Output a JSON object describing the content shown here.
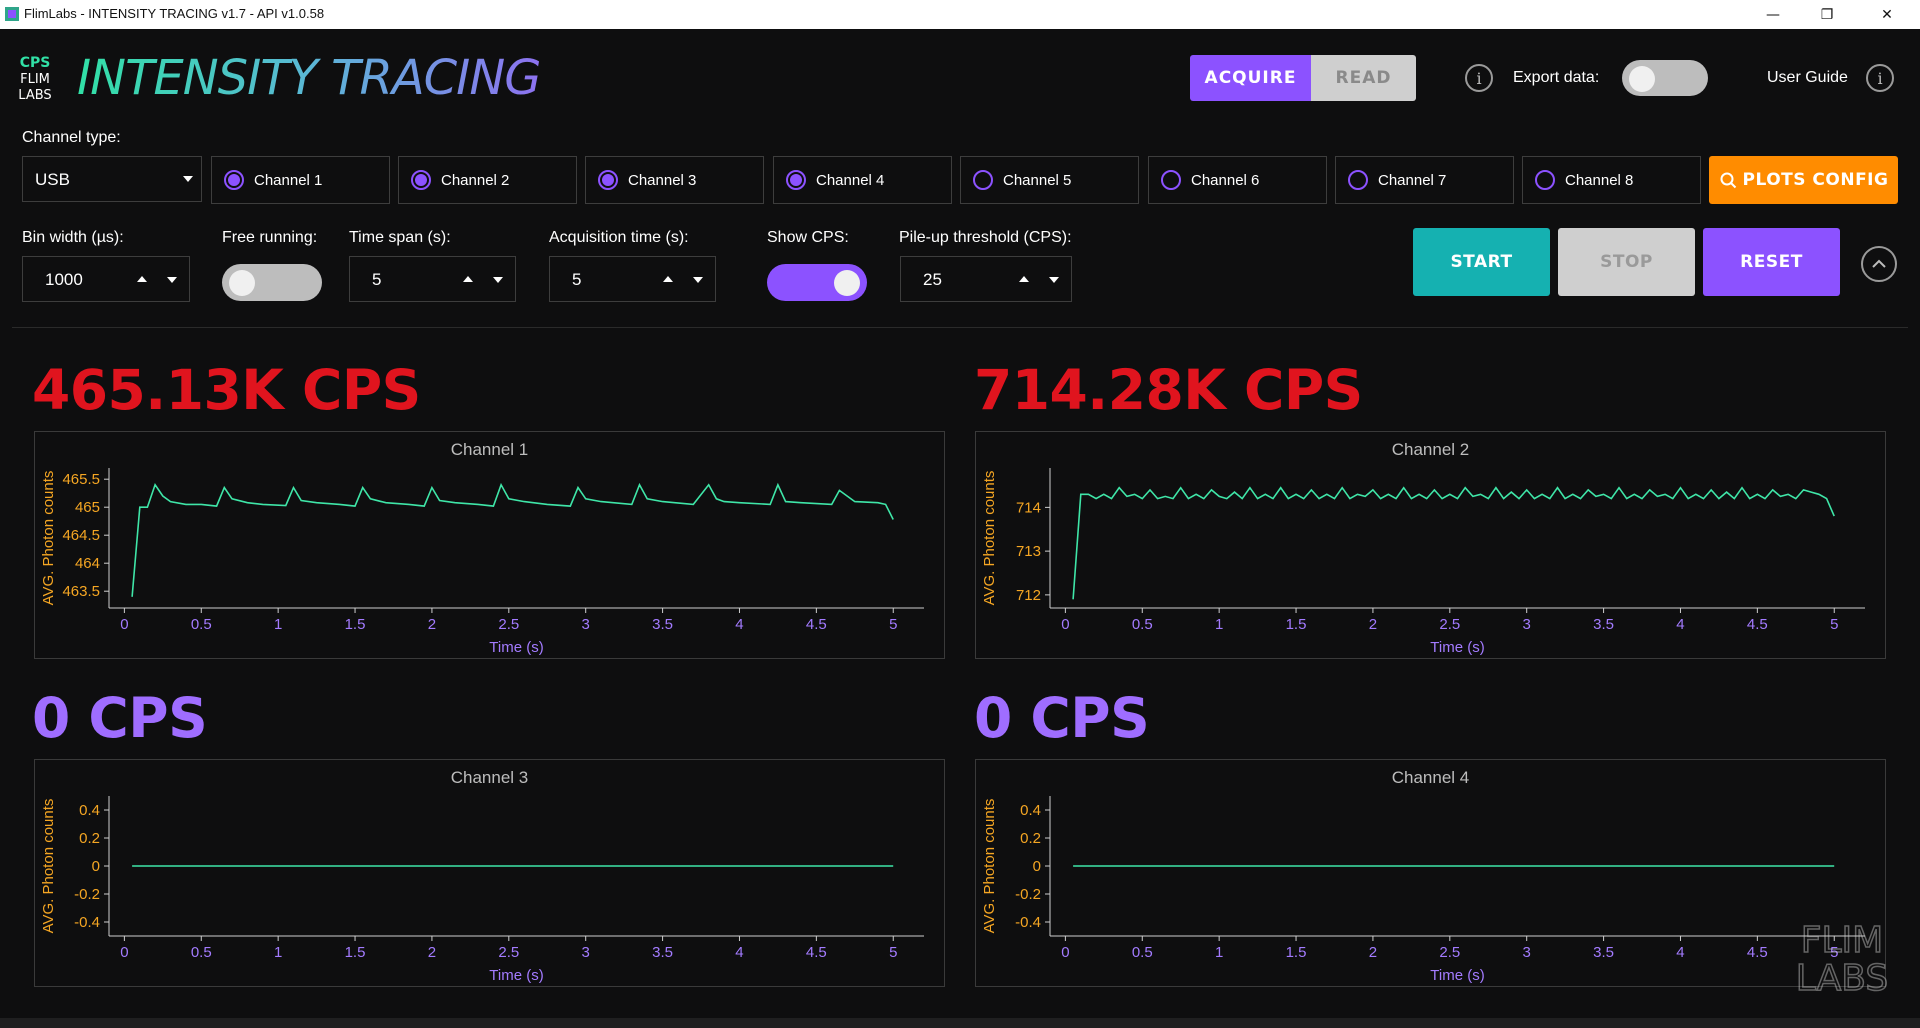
{
  "window": {
    "title": "FlimLabs - INTENSITY TRACING v1.7 - API v1.0.58",
    "minimize": "—",
    "maximize": "❐",
    "close": "✕"
  },
  "header": {
    "app_title": "INTENSITY TRACING",
    "logo_text": "CPS FLIM LABS",
    "mode_acquire": "ACQUIRE",
    "mode_read": "READ",
    "export_label": "Export data:",
    "export_on": false,
    "user_guide": "User Guide"
  },
  "controls": {
    "channel_type_label": "Channel type:",
    "channel_type_value": "USB",
    "channels": [
      {
        "label": "Channel 1",
        "checked": true
      },
      {
        "label": "Channel 2",
        "checked": true
      },
      {
        "label": "Channel 3",
        "checked": true
      },
      {
        "label": "Channel 4",
        "checked": true
      },
      {
        "label": "Channel 5",
        "checked": false
      },
      {
        "label": "Channel 6",
        "checked": false
      },
      {
        "label": "Channel 7",
        "checked": false
      },
      {
        "label": "Channel 8",
        "checked": false
      }
    ],
    "plots_config": "PLOTS CONFIG",
    "bin_width_label": "Bin width (µs):",
    "bin_width_value": "1000",
    "free_running_label": "Free running:",
    "free_running_on": false,
    "time_span_label": "Time span (s):",
    "time_span_value": "5",
    "acq_time_label": "Acquisition time (s):",
    "acq_time_value": "5",
    "show_cps_label": "Show CPS:",
    "show_cps_on": true,
    "pileup_label": "Pile-up threshold (CPS):",
    "pileup_value": "25",
    "start": "START",
    "stop": "STOP",
    "reset": "RESET"
  },
  "colors": {
    "accent": "#8c52ff",
    "teal": "#1db5b5",
    "orange": "#ff8c00",
    "cps_alert": "#e0141e",
    "cps_normal": "#9f6dff",
    "line": "#3fe6a8",
    "axis_label": "#f5a623",
    "tick": "#a37bff"
  },
  "chart_data": [
    {
      "type": "line",
      "cps": "465.13K CPS",
      "cps_alert": true,
      "title": "Channel 1",
      "xlabel": "Time (s)",
      "ylabel": "AVG. Photon counts",
      "xlim": [
        -0.1,
        5.2
      ],
      "ylim": [
        463.2,
        465.7
      ],
      "xticks": [
        "0",
        "0.5",
        "1",
        "1.5",
        "2",
        "2.5",
        "3",
        "3.5",
        "4",
        "4.5",
        "5"
      ],
      "yticks": [
        "463.5",
        "464",
        "464.5",
        "465",
        "465.5"
      ],
      "ytick_values": [
        463.5,
        464,
        464.5,
        465,
        465.5
      ],
      "x": [
        0.05,
        0.1,
        0.15,
        0.2,
        0.25,
        0.3,
        0.4,
        0.5,
        0.6,
        0.65,
        0.7,
        0.8,
        0.9,
        1.05,
        1.1,
        1.15,
        1.25,
        1.4,
        1.5,
        1.55,
        1.6,
        1.7,
        1.85,
        1.95,
        2.0,
        2.05,
        2.15,
        2.3,
        2.4,
        2.45,
        2.5,
        2.6,
        2.75,
        2.9,
        2.95,
        3.0,
        3.1,
        3.3,
        3.35,
        3.4,
        3.5,
        3.7,
        3.8,
        3.85,
        3.9,
        4.0,
        4.2,
        4.25,
        4.3,
        4.4,
        4.6,
        4.65,
        4.75,
        4.9,
        4.95,
        5.0
      ],
      "y": [
        463.4,
        465.0,
        465.0,
        465.4,
        465.2,
        465.1,
        465.05,
        465.05,
        465.02,
        465.35,
        465.15,
        465.08,
        465.05,
        465.03,
        465.35,
        465.12,
        465.08,
        465.05,
        465.02,
        465.35,
        465.15,
        465.08,
        465.05,
        465.02,
        465.35,
        465.12,
        465.08,
        465.05,
        465.02,
        465.4,
        465.15,
        465.1,
        465.05,
        465.02,
        465.35,
        465.15,
        465.1,
        465.05,
        465.4,
        465.15,
        465.1,
        465.05,
        465.4,
        465.15,
        465.1,
        465.08,
        465.05,
        465.4,
        465.1,
        465.08,
        465.05,
        465.3,
        465.1,
        465.08,
        465.05,
        464.78
      ]
    },
    {
      "type": "line",
      "cps": "714.28K CPS",
      "cps_alert": true,
      "title": "Channel 2",
      "xlabel": "Time (s)",
      "ylabel": "AVG. Photon counts",
      "xlim": [
        -0.1,
        5.2
      ],
      "ylim": [
        711.7,
        714.9
      ],
      "xticks": [
        "0",
        "0.5",
        "1",
        "1.5",
        "2",
        "2.5",
        "3",
        "3.5",
        "4",
        "4.5",
        "5"
      ],
      "yticks": [
        "712",
        "713",
        "714"
      ],
      "ytick_values": [
        712,
        713,
        714
      ],
      "x": [
        0.05,
        0.1,
        0.15,
        0.2,
        0.25,
        0.3,
        0.35,
        0.4,
        0.45,
        0.5,
        0.55,
        0.6,
        0.65,
        0.7,
        0.75,
        0.8,
        0.85,
        0.9,
        0.95,
        1.0,
        1.05,
        1.1,
        1.15,
        1.2,
        1.25,
        1.3,
        1.35,
        1.4,
        1.45,
        1.5,
        1.55,
        1.6,
        1.65,
        1.7,
        1.75,
        1.8,
        1.85,
        1.9,
        1.95,
        2.0,
        2.05,
        2.1,
        2.15,
        2.2,
        2.25,
        2.3,
        2.35,
        2.4,
        2.45,
        2.5,
        2.55,
        2.6,
        2.65,
        2.7,
        2.75,
        2.8,
        2.85,
        2.9,
        2.95,
        3.0,
        3.05,
        3.1,
        3.15,
        3.2,
        3.25,
        3.3,
        3.35,
        3.4,
        3.45,
        3.5,
        3.55,
        3.6,
        3.65,
        3.7,
        3.75,
        3.8,
        3.85,
        3.9,
        3.95,
        4.0,
        4.05,
        4.1,
        4.15,
        4.2,
        4.25,
        4.3,
        4.35,
        4.4,
        4.45,
        4.5,
        4.55,
        4.6,
        4.65,
        4.7,
        4.75,
        4.8,
        4.85,
        4.9,
        4.95,
        5.0
      ],
      "y": [
        711.9,
        714.3,
        714.3,
        714.2,
        714.3,
        714.2,
        714.45,
        714.25,
        714.3,
        714.2,
        714.4,
        714.2,
        714.25,
        714.2,
        714.45,
        714.2,
        714.3,
        714.2,
        714.4,
        714.25,
        714.2,
        714.35,
        714.2,
        714.45,
        714.2,
        714.3,
        714.2,
        714.45,
        714.2,
        714.3,
        714.2,
        714.4,
        714.2,
        714.3,
        714.2,
        714.45,
        714.2,
        714.3,
        714.25,
        714.4,
        714.2,
        714.3,
        714.2,
        714.45,
        714.2,
        714.3,
        714.2,
        714.4,
        714.2,
        714.3,
        714.2,
        714.45,
        714.25,
        714.3,
        714.2,
        714.45,
        714.2,
        714.35,
        714.2,
        714.4,
        714.2,
        714.3,
        714.2,
        714.45,
        714.2,
        714.3,
        714.2,
        714.4,
        714.25,
        714.3,
        714.2,
        714.45,
        714.2,
        714.3,
        714.2,
        714.4,
        714.25,
        714.3,
        714.2,
        714.45,
        714.2,
        714.3,
        714.2,
        714.4,
        714.2,
        714.35,
        714.2,
        714.45,
        714.2,
        714.3,
        714.2,
        714.4,
        714.25,
        714.3,
        714.2,
        714.4,
        714.35,
        714.3,
        714.2,
        713.8
      ]
    },
    {
      "type": "line",
      "cps": "0 CPS",
      "cps_alert": false,
      "title": "Channel 3",
      "xlabel": "Time (s)",
      "ylabel": "AVG. Photon counts",
      "xlim": [
        -0.1,
        5.2
      ],
      "ylim": [
        -0.5,
        0.5
      ],
      "xticks": [
        "0",
        "0.5",
        "1",
        "1.5",
        "2",
        "2.5",
        "3",
        "3.5",
        "4",
        "4.5",
        "5"
      ],
      "yticks": [
        "-0.4",
        "-0.2",
        "0",
        "0.2",
        "0.4"
      ],
      "ytick_values": [
        -0.4,
        -0.2,
        0,
        0.2,
        0.4
      ],
      "x": [
        0.05,
        5.0
      ],
      "y": [
        0,
        0
      ]
    },
    {
      "type": "line",
      "cps": "0 CPS",
      "cps_alert": false,
      "title": "Channel 4",
      "xlabel": "Time (s)",
      "ylabel": "AVG. Photon counts",
      "xlim": [
        -0.1,
        5.2
      ],
      "ylim": [
        -0.5,
        0.5
      ],
      "xticks": [
        "0",
        "0.5",
        "1",
        "1.5",
        "2",
        "2.5",
        "3",
        "3.5",
        "4",
        "4.5",
        "5"
      ],
      "yticks": [
        "-0.4",
        "-0.2",
        "0",
        "0.2",
        "0.4"
      ],
      "ytick_values": [
        -0.4,
        -0.2,
        0,
        0.2,
        0.4
      ],
      "x": [
        0.05,
        5.0
      ],
      "y": [
        0,
        0
      ]
    }
  ]
}
